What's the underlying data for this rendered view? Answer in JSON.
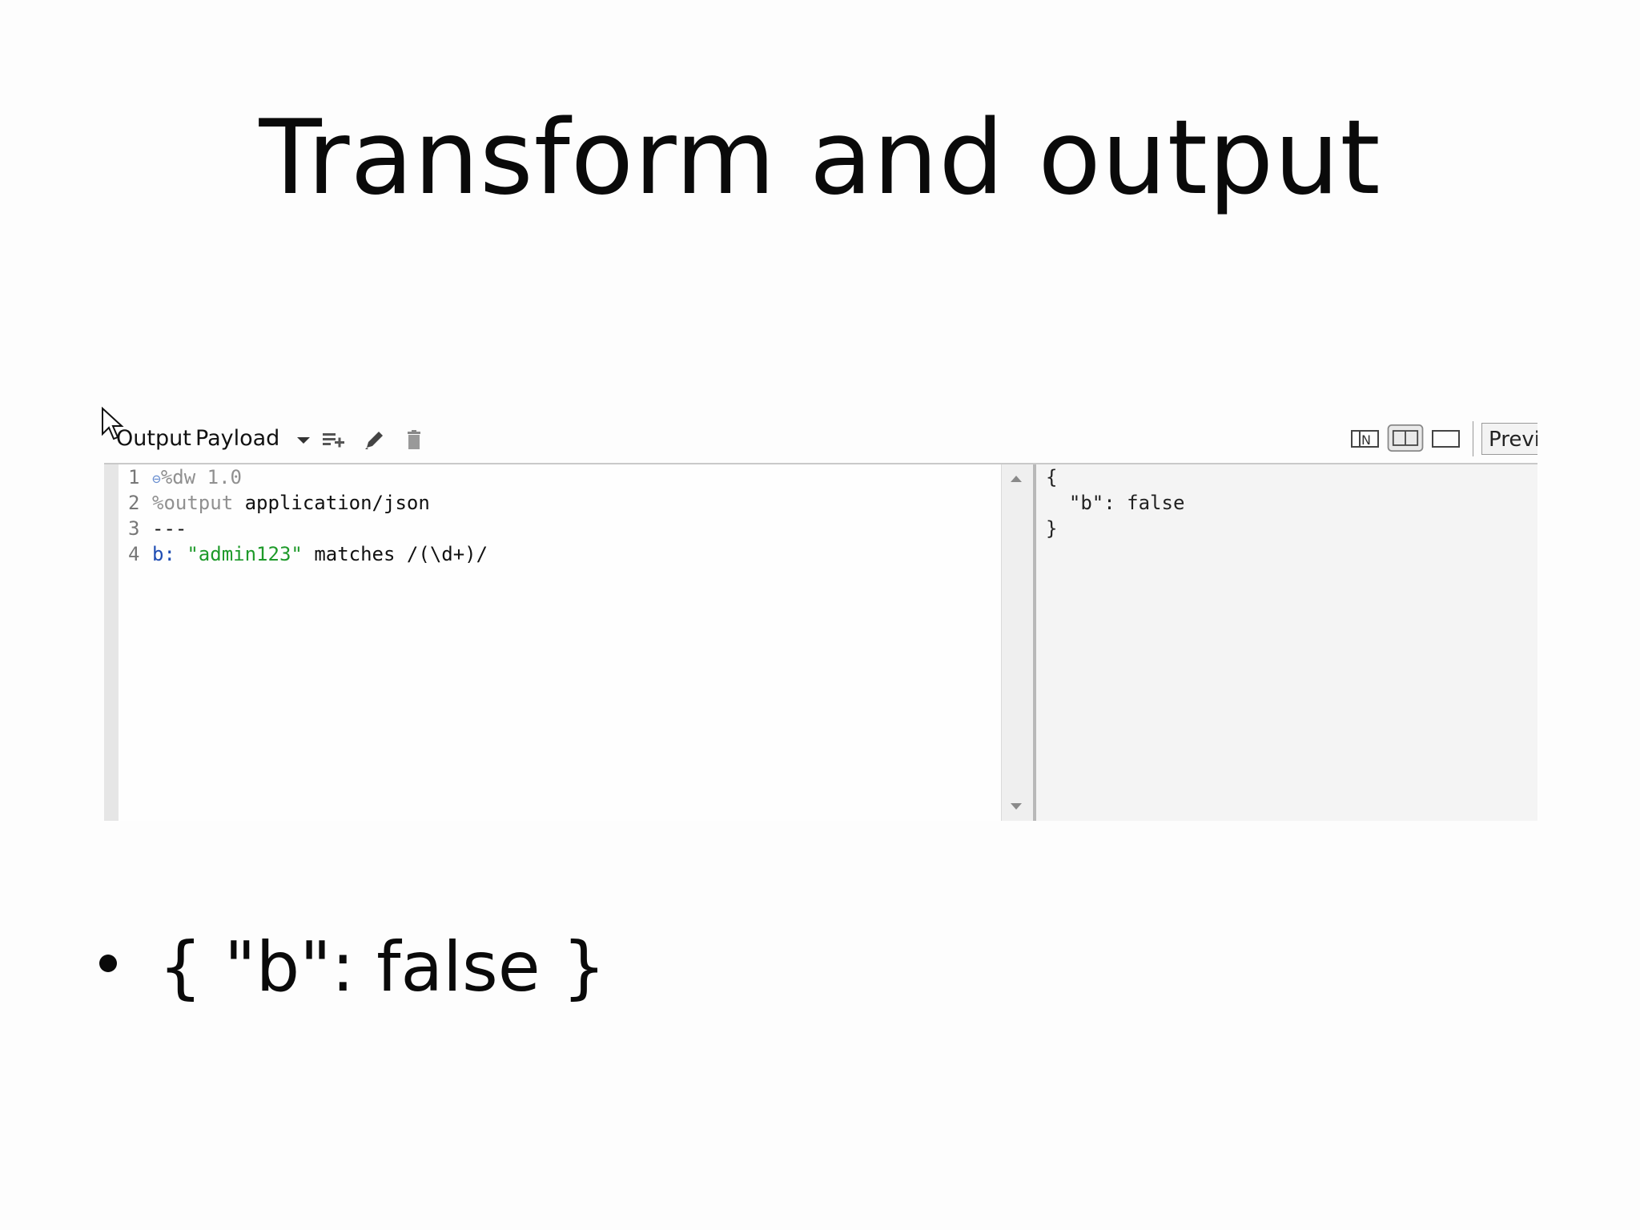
{
  "slide": {
    "title": "Transform and output",
    "bullet": "{ \"b\": false }"
  },
  "toolbar": {
    "output_label": "Output",
    "payload_label": "Payload",
    "preview_label": "Previe"
  },
  "editor": {
    "lines": [
      {
        "num": "1",
        "parts": [
          "%dw 1.0"
        ]
      },
      {
        "num": "2",
        "parts": [
          "%output",
          "application/json"
        ]
      },
      {
        "num": "3",
        "parts": [
          "---"
        ]
      },
      {
        "num": "4",
        "parts": [
          "b",
          ":",
          "\"admin123\"",
          "matches",
          "/(\\d+)/"
        ]
      }
    ]
  },
  "output": {
    "lines": [
      "{",
      "  \"b\": false",
      "}"
    ]
  },
  "icons": [
    "cursor-icon",
    "dropdown-arrow-icon",
    "add-list-icon",
    "pencil-icon",
    "trash-icon",
    "source-view-icon",
    "split-view-icon",
    "single-view-icon"
  ]
}
